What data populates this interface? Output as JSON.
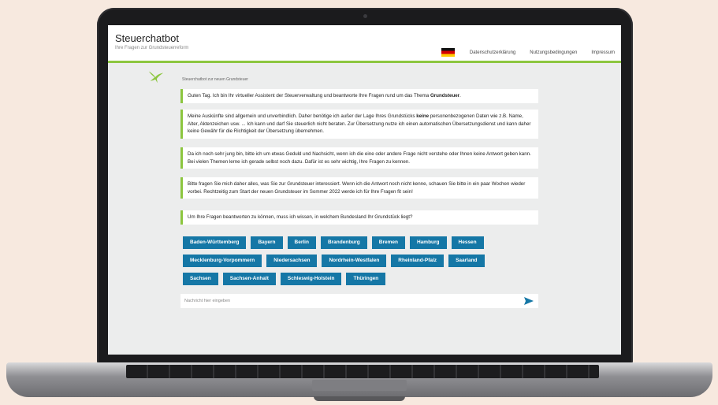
{
  "header": {
    "title": "Steuerchatbot",
    "subtitle": "Ihre Fragen zur Grundsteuerreform"
  },
  "nav": {
    "language_icon": "german-flag-icon",
    "links": [
      "Datenschutzerklärung",
      "Nutzungsbedingungen",
      "Impressum"
    ]
  },
  "chat": {
    "bot_name": "Steuerchatbot zur neuen Grundsteuer",
    "messages": [
      {
        "before": "Guten Tag. Ich bin Ihr virtueller Assistent der Steuerverwaltung und beantworte Ihre Fragen rund um das Thema ",
        "bold": "Grundsteuer",
        "after": "."
      },
      {
        "before": "Meine Auskünfte sind allgemein und unverbindlich. Daher benötige ich außer der Lage Ihres Grundstücks ",
        "bold": "keine",
        "after": " personenbezogenen Daten wie z.B. Name, Alter, Aktenzeichen usw. ... Ich kann und darf Sie steuerlich nicht beraten. Zur Übersetzung nutze ich einen automatischen Übersetzungsdienst und kann daher keine Gewähr für die Richtigkeit der Übersetzung übernehmen."
      },
      {
        "before": "Da ich noch sehr jung bin, bitte ich um etwas Geduld und Nachsicht, wenn ich die eine oder andere Frage nicht verstehe oder Ihnen keine Antwort geben kann. Bei vielen Themen lerne ich gerade selbst noch dazu. Dafür ist es sehr wichtig, Ihre Fragen zu kennen.",
        "bold": "",
        "after": ""
      },
      {
        "before": "Bitte fragen Sie mich daher alles, was Sie zur Grundsteuer interessiert. Wenn ich die Antwort noch nicht kenne, schauen Sie bitte in ein paar Wochen wieder vorbei. Rechtzeitig zum Start der neuen Grundsteuer im Sommer 2022 werde ich für Ihre Fragen fit sein!",
        "bold": "",
        "after": ""
      },
      {
        "before": "Um Ihre Fragen beantworten zu können, muss ich wissen, in welchem Bundesland Ihr Grundstück liegt?",
        "bold": "",
        "after": ""
      }
    ],
    "state_buttons": [
      [
        "Baden-Württemberg",
        "Bayern",
        "Berlin",
        "Brandenburg",
        "Bremen",
        "Hamburg",
        "Hessen"
      ],
      [
        "Mecklenburg-Vorpommern",
        "Niedersachsen",
        "Nordrhein-Westfalen",
        "Rheinland-Pfalz",
        "Saarland"
      ],
      [
        "Sachsen",
        "Sachsen-Anhalt",
        "Schleswig-Holstein",
        "Thüringen"
      ]
    ],
    "input_placeholder": "Nachricht hier eingeben",
    "send_icon": "send-arrow-icon"
  },
  "colors": {
    "accent_green": "#8cc63f",
    "button_blue": "#1577a6",
    "background": "#f7e9df"
  }
}
